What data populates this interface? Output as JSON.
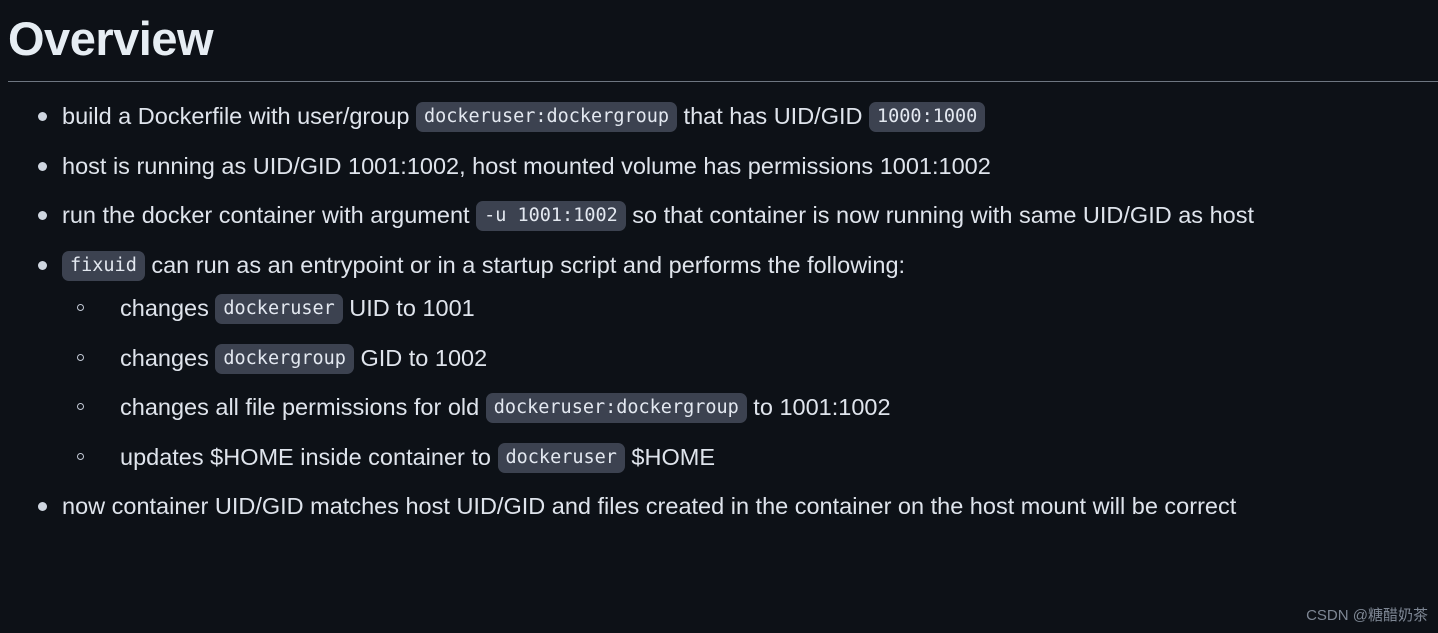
{
  "page": {
    "title": "Overview",
    "background_color": "#0d1117",
    "text_color": "#dfe4ec",
    "chip_background_color": "#3c4250",
    "rule_color": "#6e7681"
  },
  "bullets": [
    {
      "id": "bullet-dockerfile-user-group",
      "parts": [
        {
          "type": "text",
          "value": "build a Dockerfile with user/group "
        },
        {
          "type": "code",
          "value": "dockeruser:dockergroup"
        },
        {
          "type": "text",
          "value": " that has UID/GID "
        },
        {
          "type": "code",
          "value": "1000:1000"
        }
      ],
      "sub": []
    },
    {
      "id": "bullet-host-uid-gid",
      "parts": [
        {
          "type": "text",
          "value": "host is running as UID/GID 1001:1002, host mounted volume has permissions 1001:1002"
        }
      ],
      "sub": []
    },
    {
      "id": "bullet-run-docker-argument",
      "parts": [
        {
          "type": "text",
          "value": "run the docker container with argument "
        },
        {
          "type": "code",
          "value": "-u 1001:1002"
        },
        {
          "type": "text",
          "value": " so that container is now running with same UID/GID as host"
        }
      ],
      "sub": []
    },
    {
      "id": "bullet-fixuid-entrypoint",
      "parts": [
        {
          "type": "code",
          "value": "fixuid"
        },
        {
          "type": "text",
          "value": " can run as an entrypoint or in a startup script and performs the following:"
        }
      ],
      "sub": [
        {
          "id": "subbullet-changes-dockeruser-uid",
          "parts": [
            {
              "type": "text",
              "value": "changes "
            },
            {
              "type": "code",
              "value": "dockeruser"
            },
            {
              "type": "text",
              "value": " UID to 1001"
            }
          ]
        },
        {
          "id": "subbullet-changes-dockergroup-gid",
          "parts": [
            {
              "type": "text",
              "value": "changes "
            },
            {
              "type": "code",
              "value": "dockergroup"
            },
            {
              "type": "text",
              "value": " GID to 1002"
            }
          ]
        },
        {
          "id": "subbullet-changes-file-permissions",
          "parts": [
            {
              "type": "text",
              "value": "changes all file permissions for old "
            },
            {
              "type": "code",
              "value": "dockeruser:dockergroup"
            },
            {
              "type": "text",
              "value": " to 1001:1002"
            }
          ]
        },
        {
          "id": "subbullet-updates-home",
          "parts": [
            {
              "type": "text",
              "value": "updates $HOME inside container to "
            },
            {
              "type": "code",
              "value": "dockeruser"
            },
            {
              "type": "text",
              "value": " $HOME"
            }
          ]
        }
      ]
    },
    {
      "id": "bullet-container-matches-host",
      "parts": [
        {
          "type": "text",
          "value": "now container UID/GID matches host UID/GID and files created in the container on the host mount will be correct"
        }
      ],
      "sub": []
    }
  ],
  "watermark": {
    "text": "CSDN @糖醋奶茶"
  }
}
